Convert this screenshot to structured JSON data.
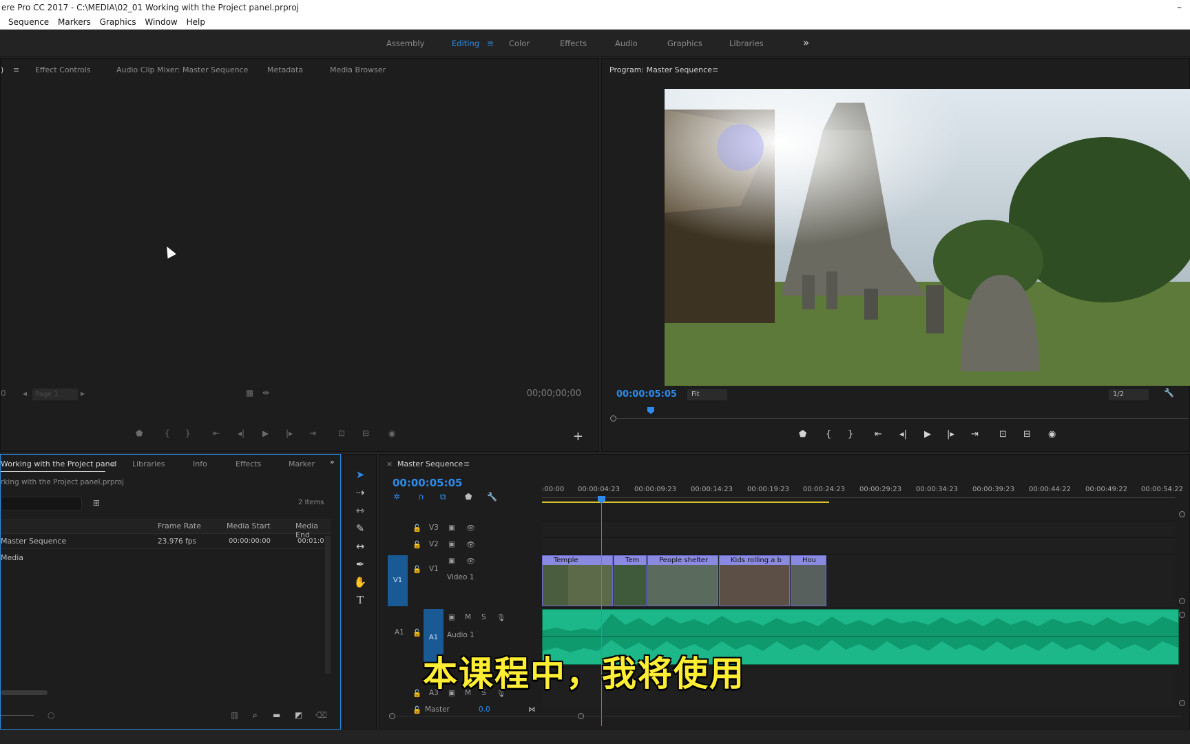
{
  "window": {
    "title": "ere Pro CC 2017 - C:\\MEDIA\\02_01 Working with the Project panel.prproj"
  },
  "menu": [
    "Sequence",
    "Markers",
    "Graphics",
    "Window",
    "Help"
  ],
  "workspaces": {
    "tabs": [
      "Assembly",
      "Editing",
      "Color",
      "Effects",
      "Audio",
      "Graphics",
      "Libraries"
    ],
    "active": "Editing"
  },
  "source": {
    "tabs": [
      "Effect Controls",
      "Audio Clip Mixer: Master Sequence",
      "Metadata",
      "Media Browser"
    ],
    "page_label": "Page 1",
    "timecode": "00;00;00;00"
  },
  "program": {
    "title": "Program: Master Sequence",
    "timecode": "00:00:05:05",
    "fit": "Fit",
    "resolution": "1/2"
  },
  "project": {
    "tabs": [
      "Working with the Project panel",
      "Libraries",
      "Info",
      "Effects",
      "Marker"
    ],
    "path": "rking with the Project panel.prproj",
    "item_count": "2 Items",
    "columns": [
      "Frame Rate",
      "Media Start",
      "Media End"
    ],
    "rows": [
      {
        "name": "Master Sequence",
        "frame_rate": "23.976 fps",
        "media_start": "00:00:00:00",
        "media_end": "00:01:0"
      },
      {
        "name": "Media",
        "frame_rate": "",
        "media_start": "",
        "media_end": ""
      }
    ]
  },
  "timeline": {
    "title": "Master Sequence",
    "timecode": "00:00:05:05",
    "ruler": [
      ":00:00",
      "00:00:04:23",
      "00:00:09:23",
      "00:00:14:23",
      "00:00:19:23",
      "00:00:24:23",
      "00:00:29:23",
      "00:00:34:23",
      "00:00:39:23",
      "00:00:44:22",
      "00:00:49:22",
      "00:00:54:22"
    ],
    "tracks": {
      "v3": "V3",
      "v2": "V2",
      "v1": "V1",
      "v1_name": "Video 1",
      "a1": "A1",
      "a1_name": "Audio 1",
      "a3": "A3",
      "master": "Master",
      "master_value": "0.0"
    },
    "clips": [
      "Temple",
      "Tem",
      "People shelter",
      "Kids rolling a b",
      "Hou"
    ]
  },
  "subtitle": "本课程中，我将使用",
  "colors": {
    "accent": "#2d8ceb",
    "audio": "#1db88a",
    "video_clip": "#8a8ae0",
    "subtitle": "#ffee33"
  }
}
